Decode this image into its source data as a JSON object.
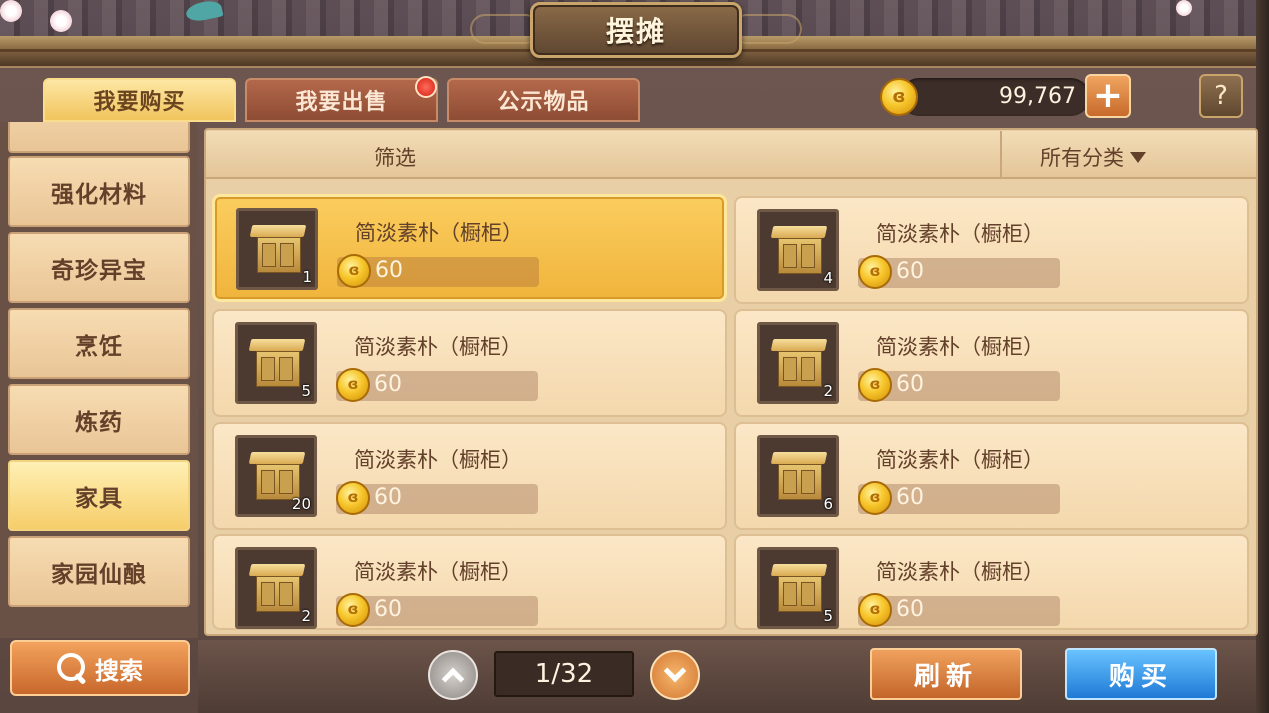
{
  "window": {
    "title": "摆摊"
  },
  "tabs": [
    {
      "label": "我要购买",
      "active": true
    },
    {
      "label": "我要出售",
      "active": false,
      "has_notification": true
    },
    {
      "label": "公示物品",
      "active": false
    }
  ],
  "currency": {
    "amount": "99,767",
    "icon": "gold-coin-icon",
    "add_icon": "+",
    "help_icon": "?"
  },
  "sidebar": {
    "categories": [
      {
        "label": "强化材料",
        "selected": false
      },
      {
        "label": "奇珍异宝",
        "selected": false
      },
      {
        "label": "烹饪",
        "selected": false
      },
      {
        "label": "炼药",
        "selected": false
      },
      {
        "label": "家具",
        "selected": true
      },
      {
        "label": "家园仙酿",
        "selected": false
      }
    ],
    "search_label": "搜索"
  },
  "filter": {
    "label": "筛选",
    "category_value": "所有分类"
  },
  "items": [
    {
      "name": "简淡素朴（橱柜）",
      "price": "60",
      "quantity": "1",
      "selected": true
    },
    {
      "name": "简淡素朴（橱柜）",
      "price": "60",
      "quantity": "4",
      "selected": false
    },
    {
      "name": "简淡素朴（橱柜）",
      "price": "60",
      "quantity": "5",
      "selected": false
    },
    {
      "name": "简淡素朴（橱柜）",
      "price": "60",
      "quantity": "2",
      "selected": false
    },
    {
      "name": "简淡素朴（橱柜）",
      "price": "60",
      "quantity": "20",
      "selected": false
    },
    {
      "name": "简淡素朴（橱柜）",
      "price": "60",
      "quantity": "6",
      "selected": false
    },
    {
      "name": "简淡素朴（橱柜）",
      "price": "60",
      "quantity": "2",
      "selected": false
    },
    {
      "name": "简淡素朴（橱柜）",
      "price": "60",
      "quantity": "5",
      "selected": false
    }
  ],
  "pagination": {
    "current": "1/32"
  },
  "actions": {
    "refresh_label": "刷新",
    "buy_label": "购买"
  },
  "colors": {
    "accent_gold": "#f1c45d",
    "buy_blue": "#1f7ad6",
    "refresh_orange": "#c3652a"
  }
}
